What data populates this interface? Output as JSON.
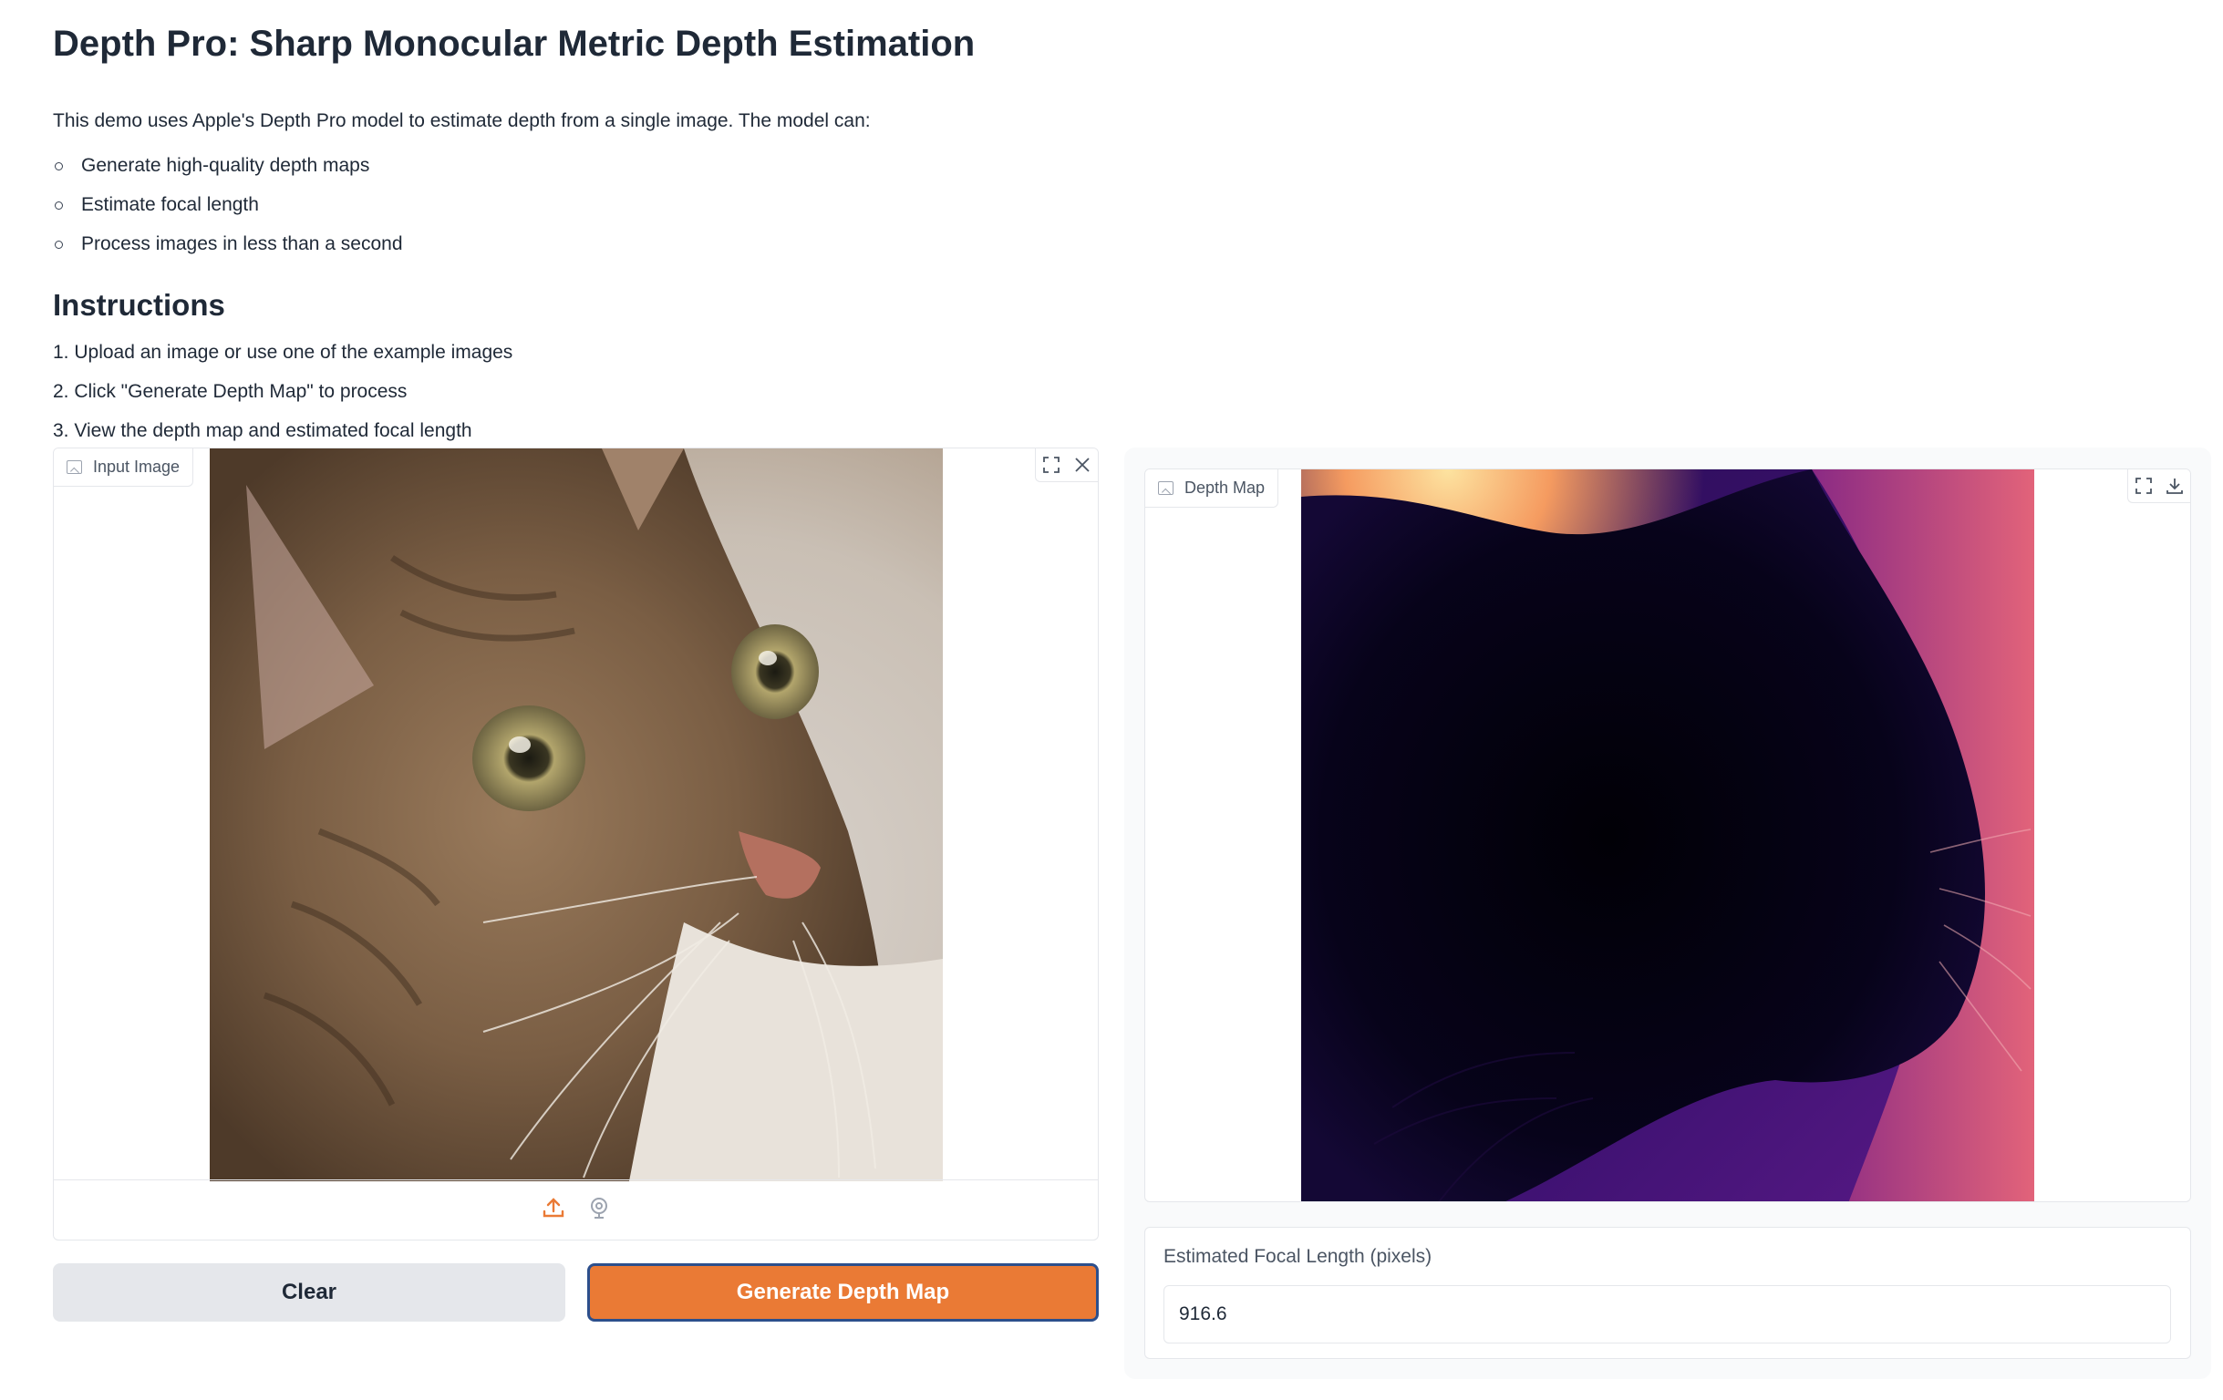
{
  "header": {
    "title": "Depth Pro: Sharp Monocular Metric Depth Estimation",
    "intro": "This demo uses Apple's Depth Pro model to estimate depth from a single image. The model can:",
    "features": [
      "Generate high-quality depth maps",
      "Estimate focal length",
      "Process images in less than a second"
    ],
    "instructions_title": "Instructions",
    "steps": [
      "1. Upload an image or use one of the example images",
      "2. Click \"Generate Depth Map\" to process",
      "3. View the depth map and estimated focal length"
    ]
  },
  "input_panel": {
    "label": "Input Image",
    "icons": [
      "image-icon",
      "fullscreen-icon",
      "close-icon",
      "upload-icon",
      "webcam-icon"
    ]
  },
  "buttons": {
    "clear": "Clear",
    "generate": "Generate Depth Map"
  },
  "output_panel": {
    "depth_label": "Depth Map",
    "icons": [
      "image-icon",
      "fullscreen-icon",
      "download-icon"
    ],
    "focal_label": "Estimated Focal Length (pixels)",
    "focal_value": "916.6"
  },
  "colors": {
    "primary_button": "#ea7a35",
    "primary_button_border": "#2c4f8c",
    "secondary_button": "#e5e7eb",
    "upload_icon": "#ea7a35"
  }
}
